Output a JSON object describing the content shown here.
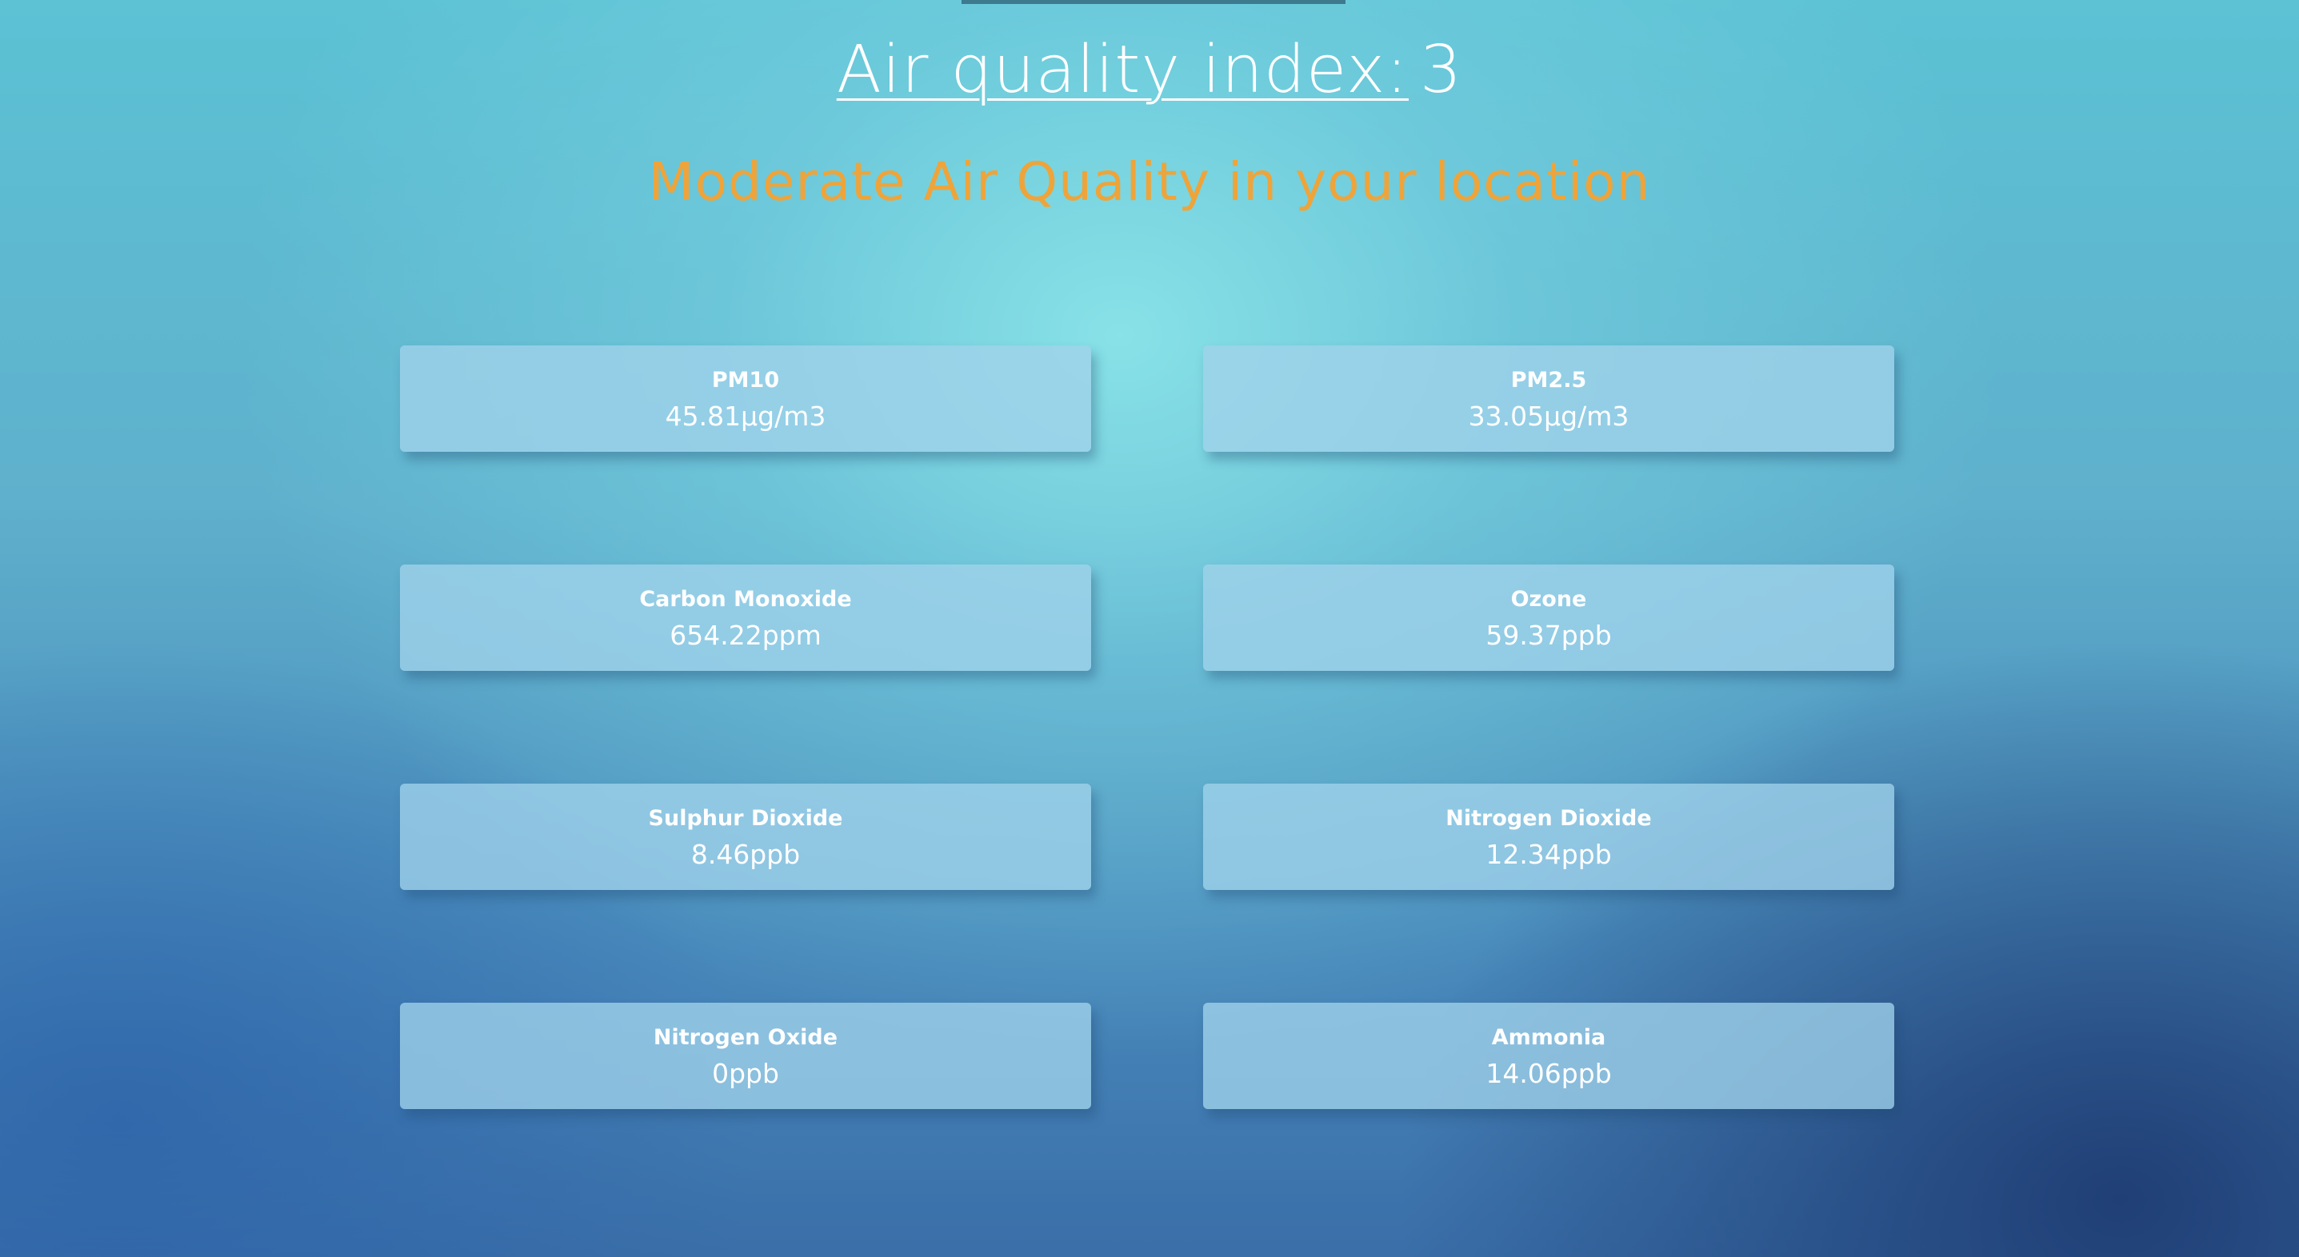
{
  "header": {
    "title_label": "Air quality index:",
    "aqi_value": "3",
    "subtitle": "Moderate Air Quality in your location"
  },
  "colors": {
    "subtitle": "#eea43a",
    "text": "#ffffff"
  },
  "pollutants": [
    {
      "label": "PM10",
      "value": "45.81μg/m3"
    },
    {
      "label": "PM2.5",
      "value": "33.05μg/m3"
    },
    {
      "label": "Carbon Monoxide",
      "value": "654.22ppm"
    },
    {
      "label": "Ozone",
      "value": "59.37ppb"
    },
    {
      "label": "Sulphur Dioxide",
      "value": "8.46ppb"
    },
    {
      "label": "Nitrogen Dioxide",
      "value": "12.34ppb"
    },
    {
      "label": "Nitrogen Oxide",
      "value": "0ppb"
    },
    {
      "label": "Ammonia",
      "value": "14.06ppb"
    }
  ]
}
